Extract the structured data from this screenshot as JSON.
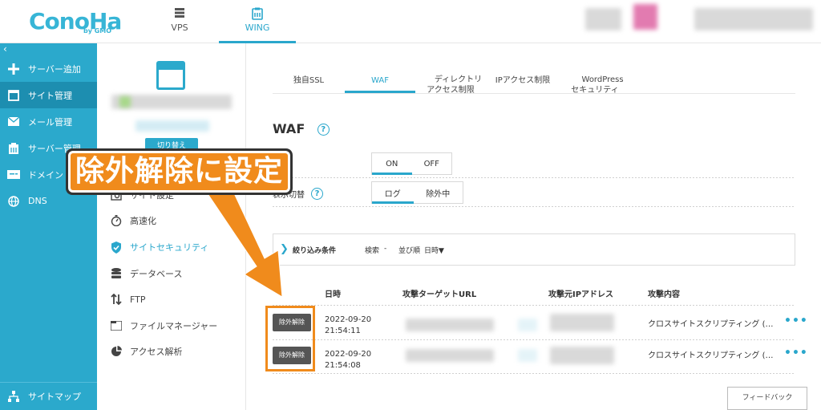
{
  "brand": {
    "logo": "ConoHa",
    "logo_sub": "by GMO"
  },
  "top_tabs": [
    {
      "label": "VPS",
      "icon": "server-icon",
      "active": false
    },
    {
      "label": "WING",
      "icon": "wing-server-icon",
      "active": true
    }
  ],
  "sidebar": {
    "collapse": "‹",
    "items": [
      {
        "label": "サーバー追加",
        "icon": "plus-icon"
      },
      {
        "label": "サイト管理",
        "icon": "window-icon",
        "active": true
      },
      {
        "label": "メール管理",
        "icon": "mail-icon"
      },
      {
        "label": "サーバー管理",
        "icon": "server-stack-icon"
      },
      {
        "label": "ドメイン",
        "icon": "domain-icon"
      },
      {
        "label": "DNS",
        "icon": "globe-icon"
      }
    ],
    "bottom": {
      "label": "サイトマップ",
      "icon": "sitemap-icon"
    }
  },
  "site_panel": {
    "switch_label": "切り替え",
    "menu": [
      {
        "label": "サイト設定",
        "icon": "settings-icon"
      },
      {
        "label": "高速化",
        "icon": "stopwatch-icon"
      },
      {
        "label": "サイトセキュリティ",
        "icon": "shield-icon",
        "active": true
      },
      {
        "label": "データベース",
        "icon": "database-icon"
      },
      {
        "label": "FTP",
        "icon": "transfer-icon"
      },
      {
        "label": "ファイルマネージャー",
        "icon": "folder-icon"
      },
      {
        "label": "アクセス解析",
        "icon": "pie-chart-icon"
      }
    ]
  },
  "sub_tabs": [
    {
      "label": "独自SSL"
    },
    {
      "label": "WAF",
      "active": true
    },
    {
      "label": "ディレクトリ\nアクセス制限"
    },
    {
      "label": "IPアクセス制限"
    },
    {
      "label": "WordPress\nセキュリティ"
    }
  ],
  "waf": {
    "title": "WAF",
    "help": "?",
    "toggle_on": "ON",
    "toggle_off": "OFF",
    "display_label": "表示切替",
    "view_log": "ログ",
    "view_excluded": "除外中"
  },
  "filter": {
    "label": "絞り込み条件",
    "search": "検索",
    "search_value": "-",
    "sort": "並び順",
    "sort_value": "日時▼"
  },
  "table": {
    "headers": [
      "日時",
      "攻撃ターゲットURL",
      "攻撃元IPアドレス",
      "攻撃内容"
    ],
    "rows": [
      {
        "button": "除外解除",
        "date": "2022-09-20",
        "time": "21:54:11",
        "attack": "クロスサイトスクリプティング (…",
        "more": "•••"
      },
      {
        "button": "除外解除",
        "date": "2022-09-20",
        "time": "21:54:08",
        "attack": "クロスサイトスクリプティング (…",
        "more": "•••"
      }
    ]
  },
  "feedback": "フィードバック",
  "annotation": {
    "text": "除外解除に設定",
    "color": "#f08b1c"
  }
}
